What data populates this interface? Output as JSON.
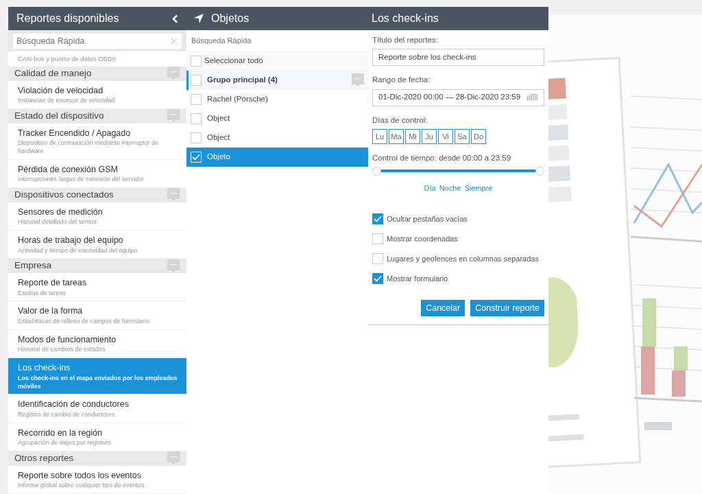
{
  "reports_panel": {
    "title": "Reportes disponibles",
    "search": {
      "placeholder": "Búsqueda Rápida"
    },
    "partial_subtitle": "CAN-bus y puerto de datos OBDII",
    "groups": [
      {
        "title": "Calidad de manejo",
        "items": [
          {
            "title": "Violación de velocidad",
            "subtitle": "Instancias de excesos de velocidad",
            "selected": false
          }
        ]
      },
      {
        "title": "Estado del dispositivo",
        "items": [
          {
            "title": "Tracker Encendido / Apagado",
            "subtitle": "Dispositivo de conmutación mediante interruptor de hardware",
            "selected": false
          },
          {
            "title": "Pérdida de conexión GSM",
            "subtitle": "Interrupciones largas de conexión del servidor",
            "selected": false
          }
        ]
      },
      {
        "title": "Dispositivos conectados",
        "items": [
          {
            "title": "Sensores de medición",
            "subtitle": "Historial detallado del sensor",
            "selected": false
          },
          {
            "title": "Horas de trabajo del equipo",
            "subtitle": "Actividad y tiempo de inactividad del equipo",
            "selected": false
          }
        ]
      },
      {
        "title": "Empresa",
        "items": [
          {
            "title": "Reporte de tareas",
            "subtitle": "Estatus de tareas",
            "selected": false
          },
          {
            "title": "Valor de la forma",
            "subtitle": "Estadísticas de relleno de campos de formulario",
            "selected": false
          },
          {
            "title": "Modos de funcionamiento",
            "subtitle": "Historial de cambios de estados",
            "selected": false
          },
          {
            "title": "Los check-ins",
            "subtitle": "Los check-ins en el mapa enviados por los empleados móviles",
            "selected": true
          },
          {
            "title": "Identificación de conductores",
            "subtitle": "Registro de cambio de conductores",
            "selected": false
          },
          {
            "title": "Recorrido en la región",
            "subtitle": "Agrupación de viajes por regiones",
            "selected": false
          }
        ]
      },
      {
        "title": "Otros reportes",
        "items": [
          {
            "title": "Reporte sobre todos los eventos",
            "subtitle": "Informe global sobre cualquier tipo de eventos",
            "selected": false
          }
        ]
      }
    ]
  },
  "objects_panel": {
    "title": "Objetos",
    "search": {
      "placeholder": "Búsqueda Rápida"
    },
    "select_all": {
      "label": "Seleccionar todo",
      "checked": false
    },
    "groups": [
      {
        "label": "Grupo principal (4)",
        "checked": false,
        "selected": true,
        "children": [
          {
            "label": "Rachel (Porsche)",
            "checked": false,
            "selected": false
          },
          {
            "label": "Object",
            "checked": false,
            "selected": false
          },
          {
            "label": "Object",
            "checked": false,
            "selected": false
          },
          {
            "label": "Objeto",
            "checked": true,
            "selected": true
          }
        ]
      }
    ]
  },
  "form": {
    "title": "Los check-ins",
    "report_title_label": "Título del reportes:",
    "report_title_value": "Reporte sobre los check-ins",
    "date_range_label": "Rango de fecha:",
    "date_range_value": "01-Dic-2020 00:00 — 28-Dic-2020 23:59",
    "days_label": "Días de control:",
    "days": [
      {
        "label": "Lu",
        "selected": false
      },
      {
        "label": "Ma",
        "selected": false
      },
      {
        "label": "Mi",
        "selected": false
      },
      {
        "label": "Ju",
        "selected": false
      },
      {
        "label": "Vi",
        "selected": false
      },
      {
        "label": "Sa",
        "selected": false
      },
      {
        "label": "Do",
        "selected": false
      }
    ],
    "time_control": {
      "label": "Control de tiempo: desde 00:00 a 23:59",
      "level": 1,
      "presets": [
        "Día",
        "Noche",
        "Siempre"
      ]
    },
    "options": [
      {
        "label": "Ocultar pestañas vacías",
        "checked": true
      },
      {
        "label": "Mostrar coordenadas",
        "checked": false
      },
      {
        "label": "Lugares y geofences en columnas separadas",
        "checked": false
      },
      {
        "label": "Mostrar formulario",
        "checked": true
      }
    ],
    "buttons": [
      "Cancelar",
      "Construir reporte"
    ]
  }
}
